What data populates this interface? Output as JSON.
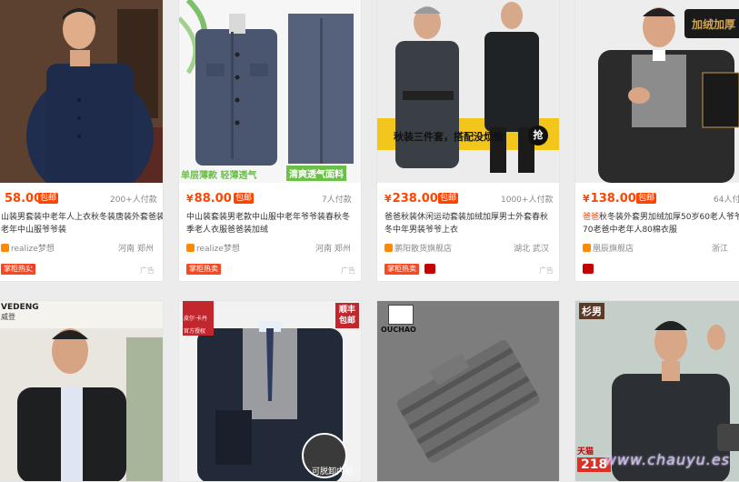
{
  "products": [
    {
      "price": "58.00",
      "badge": "包邮",
      "sales": "200+人付款",
      "title": "山装男套装中老年人上衣秋冬装唐装外套爸装老年中山服爷爷装",
      "shop": "realize梦想",
      "location": "河南 郑州",
      "tag": "掌柜热卖",
      "ad": "广告"
    },
    {
      "price": "88.00",
      "badge": "包邮",
      "sales": "7人付款",
      "title": "中山装套装男老款中山服中老年爷爷装春秋冬季老人衣服爸爸装加绒",
      "shop": "realize梦想",
      "location": "河南 郑州",
      "tag": "掌柜热卖",
      "ad": "广告",
      "image_labels": [
        "单层薄款 轻薄透气",
        "清爽透气面料"
      ]
    },
    {
      "price": "238.00",
      "badge": "包邮",
      "sales": "1000+人付款",
      "title": "爸爸秋装休闲运动套装加绒加厚男士外套春秋冬中年男装爷爷上衣",
      "shop": "鹏阳散货旗舰店",
      "location": "湖北 武汉",
      "tag": "掌柜热卖",
      "ad": "广告",
      "image_labels": [
        "秋装三件套，搭配没烦恼",
        "抢"
      ]
    },
    {
      "price": "138.00",
      "badge": "包邮",
      "sales": "64人付",
      "title_prefix": "爸爸",
      "title": "秋冬装外套男加绒加厚50岁60老人爷爷70老爸中老年人80棉衣服",
      "shop": "凰辰旗舰店",
      "location": "浙江",
      "image_labels": [
        "加绒加厚"
      ]
    },
    {
      "image_labels": [
        "VEDENG",
        "威登"
      ]
    },
    {
      "image_labels": [
        "皮尔·卡丹",
        "官方授权",
        "顺丰包邮",
        "可脱卸内胆"
      ]
    },
    {
      "image_labels": [
        "OUCHAO"
      ]
    },
    {
      "image_labels": [
        "杉男",
        "天猫",
        "218"
      ]
    }
  ],
  "watermark": "www.chauyu.es",
  "colors": {
    "price": "#ff4400",
    "tag": "#f54a21",
    "tmall": "#c40000"
  }
}
